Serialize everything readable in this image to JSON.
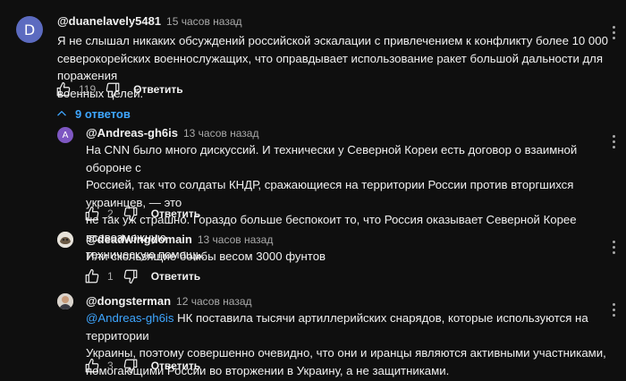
{
  "comments": [
    {
      "author": "@duanelavely5481",
      "time": "15 часов назад",
      "avatar_letter": "D",
      "avatar_color": "#5c6bc0",
      "lines": [
        "Я не слышал никаких обсуждений российской эскалации с привлечением к конфликту более 10 000",
        "северокорейских военнослужащих, что оправдывает использование ракет большой дальности для поражения",
        "военных целей."
      ],
      "likes": "119",
      "reply_label": "Ответить"
    }
  ],
  "replies_toggle": {
    "label": "9 ответов",
    "icon": "chevron-up-icon"
  },
  "replies": [
    {
      "author": "@Andreas-gh6is",
      "time": "13 часов назад",
      "avatar_letter": "A",
      "avatar_color": "#7e57c2",
      "lines": [
        "На CNN было много дискуссий. И технически у Северной Кореи есть договор о взаимной обороне с",
        "Россией, так что солдаты КНДР, сражающиеся на территории России против вторгшихся украинцев, — это",
        "не так уж страшно. Гораздо больше беспокоит то, что Россия оказывает Северной Корее всевозможную",
        "техническую помощь."
      ],
      "likes": "2",
      "reply_label": "Ответить"
    },
    {
      "author": "@deadwingdomain",
      "time": "13 часов назад",
      "lines": [
        "Или скользящие бомбы весом 3000 фунтов"
      ],
      "likes": "1",
      "reply_label": "Ответить"
    },
    {
      "author": "@dongsterman",
      "time": "12 часов назад",
      "mention": "@Andreas-gh6is",
      "lines": [
        " НК поставила тысячи артиллерийских снарядов, которые используются на территории",
        "Украины, поэтому совершенно очевидно, что они и иранцы являются активными участниками,",
        "помогающими России во вторжении в Украину, а не защитниками."
      ],
      "likes": "3",
      "reply_label": "Ответить"
    }
  ],
  "colors": {
    "link": "#3ea6ff",
    "background": "#0f0f0f",
    "secondary_text": "#aaaaaa"
  },
  "icons": [
    "like-icon",
    "dislike-icon",
    "more-vert-icon",
    "chevron-up-icon"
  ]
}
